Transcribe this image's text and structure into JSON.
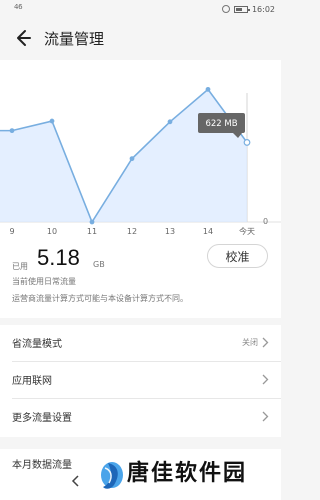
{
  "status_bar": {
    "signal_text": "46",
    "time": "16:02"
  },
  "header": {
    "title": "流量管理"
  },
  "chart_data": {
    "type": "area",
    "categories": [
      "9",
      "10",
      "11",
      "12",
      "13",
      "14",
      "今天"
    ],
    "values": [
      620,
      685,
      0,
      430,
      680,
      900,
      540
    ],
    "ylim": [
      0,
      950
    ],
    "zero_label": "0",
    "tooltip": "622 MB",
    "line_color": "#78aee0",
    "fill_color": "#dbeaff"
  },
  "summary": {
    "used_label": "已用",
    "usage_value": "5.18",
    "unit": "GB",
    "calibrate_label": "校准",
    "description_1": "当前使用日常流量",
    "description_2": "运营商流量计算方式可能与本设备计算方式不同。"
  },
  "settings": [
    {
      "label": "省流量模式",
      "value": "关闭"
    },
    {
      "label": "应用联网",
      "value": ""
    },
    {
      "label": "更多流量设置",
      "value": ""
    }
  ],
  "partial_section": {
    "heading": "本月数据流量"
  },
  "watermark": {
    "text": "唐佳软件园"
  }
}
